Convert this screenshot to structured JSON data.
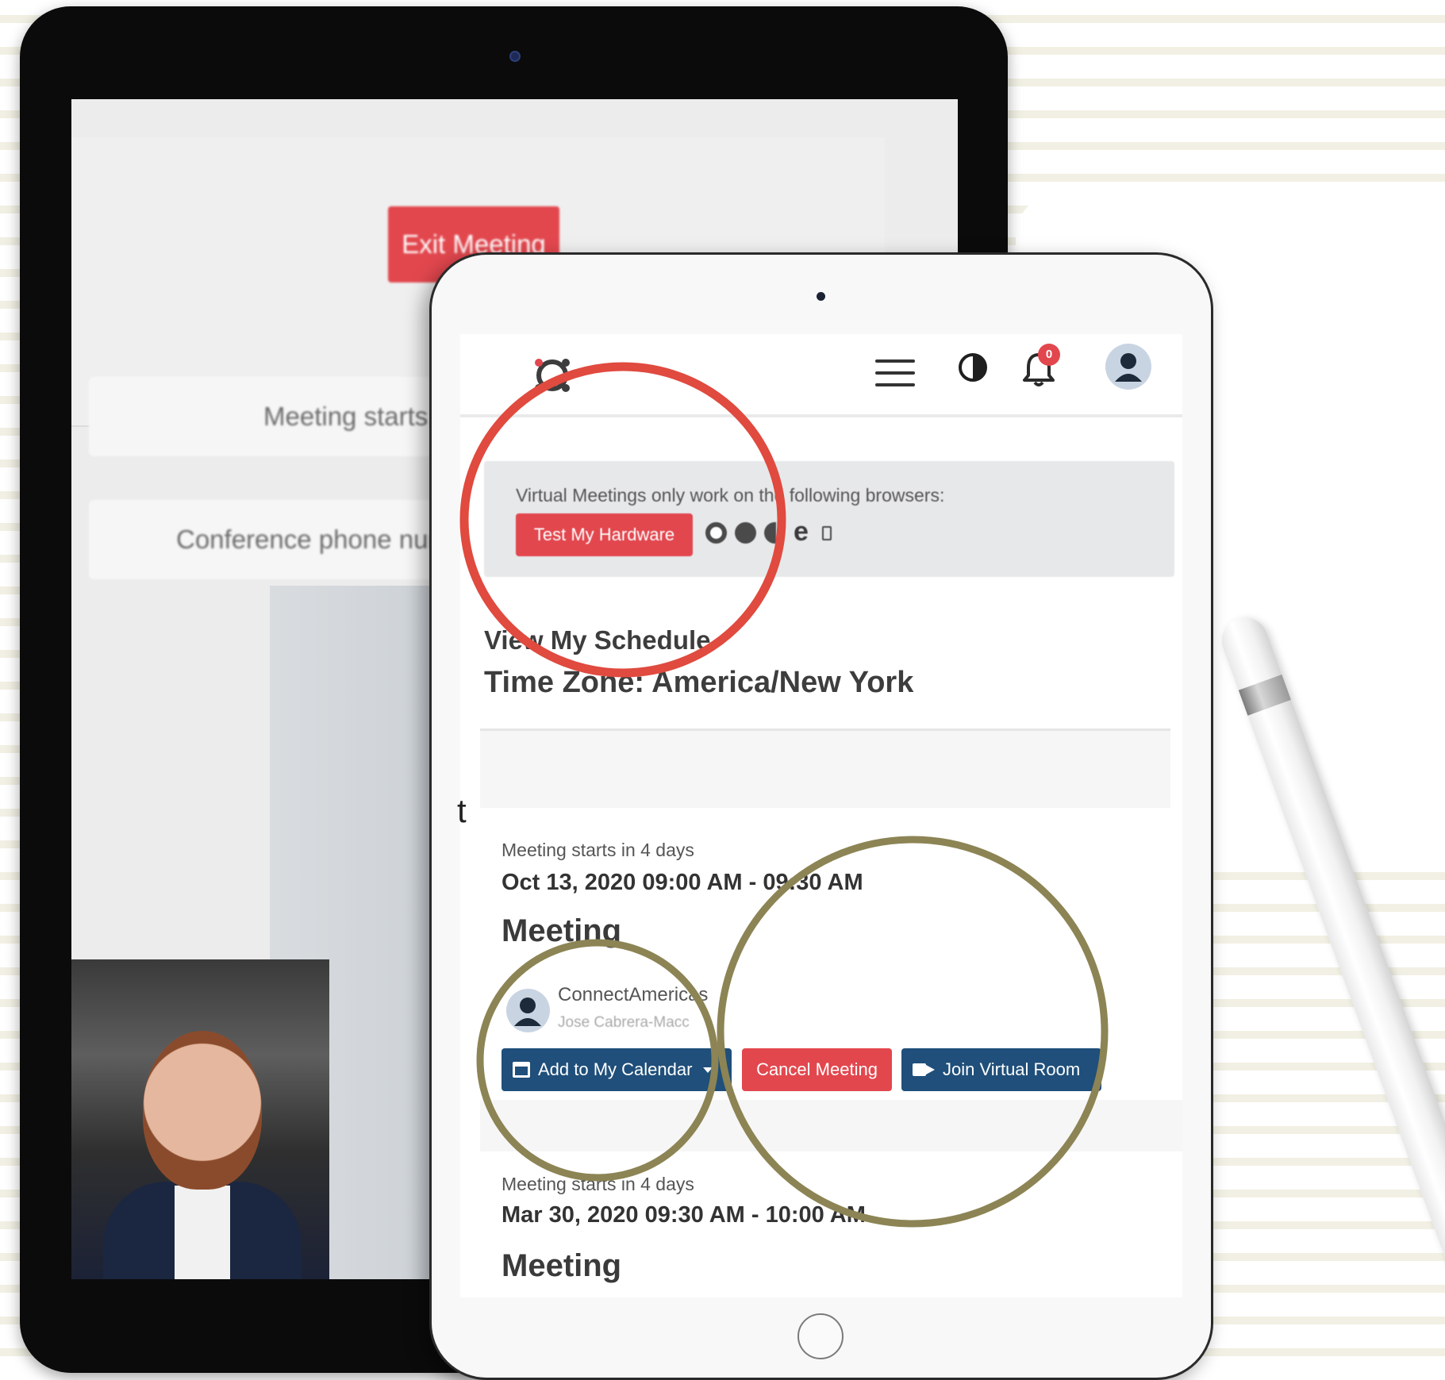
{
  "back_tablet": {
    "exit_button_label": "Exit Meeting",
    "card_1_text": "Meeting starts",
    "card_2_text": "Conference phone numb"
  },
  "header": {
    "notification_count": "0"
  },
  "banner": {
    "text": "Virtual Meetings only work on the following browsers:",
    "test_hardware_label": "Test My Hardware",
    "browser_icons": [
      "chrome-icon",
      "firefox-icon",
      "safari-icon",
      "edge-icon",
      "opera-icon"
    ]
  },
  "schedule": {
    "title": "View My Schedule",
    "time_zone": "Time Zone: America/New York"
  },
  "stray_text": "t",
  "meetings": [
    {
      "starts_in": "Meeting starts in 4 days",
      "date_range": "Oct  13, 2020 09:00 AM - 09:30 AM",
      "title": "Meeting",
      "host_name": "ConnectAmericas",
      "host_sub": "Jose Cabrera-Macc",
      "add_calendar_label": "Add to My Calendar",
      "cancel_label": "Cancel Meeting",
      "join_label": "Join Virtual Room"
    },
    {
      "starts_in": "Meeting starts in 4 days",
      "date_range": "Mar 30, 2020 09:30 AM - 10:00 AM",
      "title": "Meeting"
    }
  ],
  "colors": {
    "accent_red": "#e2474e",
    "primary_blue": "#1f4f7a",
    "annotation_red": "#e04a3f",
    "annotation_olive": "#8c8454"
  }
}
